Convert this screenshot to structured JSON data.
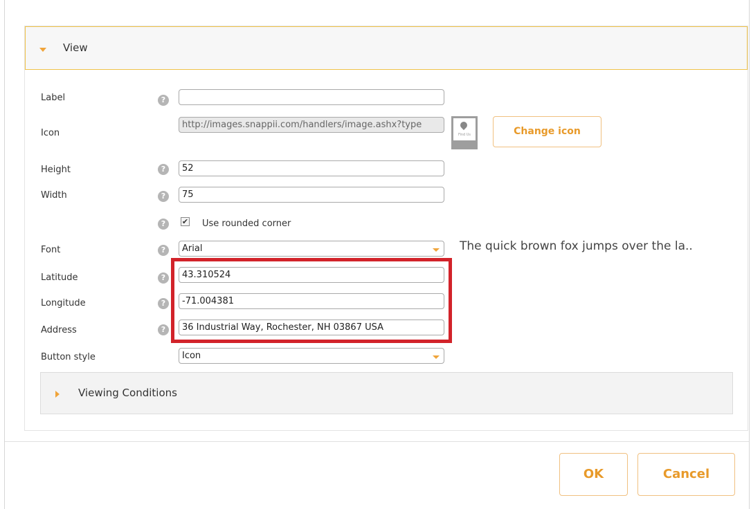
{
  "view_section": {
    "title": "View"
  },
  "fields": {
    "label": {
      "label": "Label",
      "value": ""
    },
    "icon": {
      "label": "Icon",
      "value": "http://images.snappii.com/handlers/image.ashx?type",
      "preview_caption": "Find Us",
      "change_button": "Change icon"
    },
    "height": {
      "label": "Height",
      "value": "52"
    },
    "width": {
      "label": "Width",
      "value": "75"
    },
    "rounded_corner": {
      "label": "Use rounded corner",
      "checked": true
    },
    "font": {
      "label": "Font",
      "value": "Arial",
      "preview": "The quick brown fox jumps over the la.."
    },
    "latitude": {
      "label": "Latitude",
      "value": "43.310524"
    },
    "longitude": {
      "label": "Longitude",
      "value": "-71.004381"
    },
    "address": {
      "label": "Address",
      "value": "36 Industrial Way,  Rochester, NH 03867 USA"
    },
    "button_style": {
      "label": "Button style",
      "value": "Icon"
    }
  },
  "help_glyph": "?",
  "check_glyph": "✔",
  "viewing_conditions": {
    "title": "Viewing Conditions"
  },
  "footer": {
    "ok": "OK",
    "cancel": "Cancel"
  },
  "colors": {
    "accent": "#f0a43a",
    "highlight": "#d2232a",
    "header_border": "#f0c34a"
  }
}
